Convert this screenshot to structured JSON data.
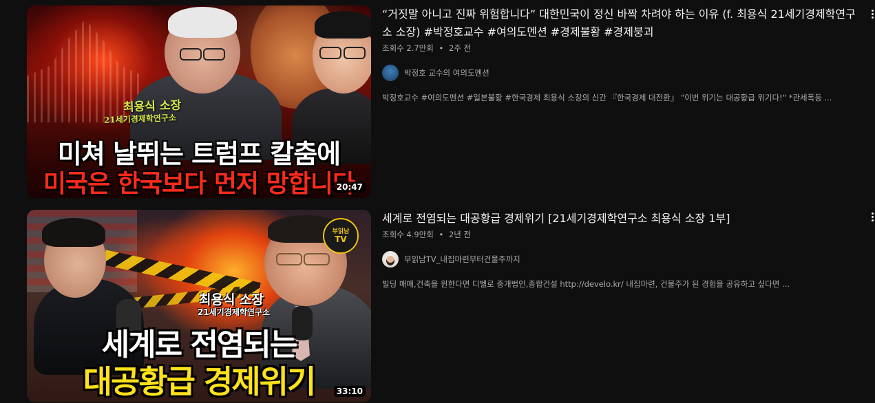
{
  "videos": [
    {
      "title": "“거짓말 아니고 진짜 위험합니다” 대한민국이 정신 바짝 차려야 하는 이유 (f. 최용식 21세기경제학연구소 소장) #박정호교수 #여의도멘션 #경제불황 #경제붕괴",
      "views": "조회수 2.7만회",
      "age": "2주 전",
      "channel": "박정호 교수의 여의도멘션",
      "description": "박정호교수 #여의도멘션 #일본불황 #한국경제 최용식 소장의 신간 『한국경제 대전환』 \"이번 위기는 대공황급 위기다!\" *관세폭등 ...",
      "duration": "20:47",
      "thumbnail": {
        "guest_name": "최용식 소장",
        "guest_org": "21세기경제학연구소",
        "headline_1": "미쳐 날뛰는 트럼프 칼춤에",
        "headline_2": "미국은 한국보다 먼저 망합니다"
      }
    },
    {
      "title": "세계로 전염되는 대공황급 경제위기 [21세기경제학연구소 최용식 소장 1부]",
      "views": "조회수 4.9만회",
      "age": "2년 전",
      "channel": "부읽남TV_내집마련부터건물주까지",
      "description": "빌딩 매매,건축을 원한다면 디벨로 중개법인,종합건설 http://develo.kr/ 내집마련, 건물주가 된 경험을 공유하고 싶다면 ...",
      "duration": "33:10",
      "thumbnail": {
        "logo_line_1": "부읽남",
        "logo_line_2": "TV",
        "guest_name": "최용식 소장",
        "guest_org": "21세기경제학연구소",
        "headline_1": "세계로 전염되는",
        "headline_2": "대공황급 경제위기"
      }
    }
  ],
  "separator": "•",
  "icons": {
    "menu": "more-vert-icon"
  },
  "colors": {
    "background": "#0f0f0f",
    "title_text": "#f1f1f1",
    "meta_text": "#aaaaaa",
    "t1_headline_red": "#ff2a1a",
    "t2_headline_yellow": "#ffe21a"
  }
}
